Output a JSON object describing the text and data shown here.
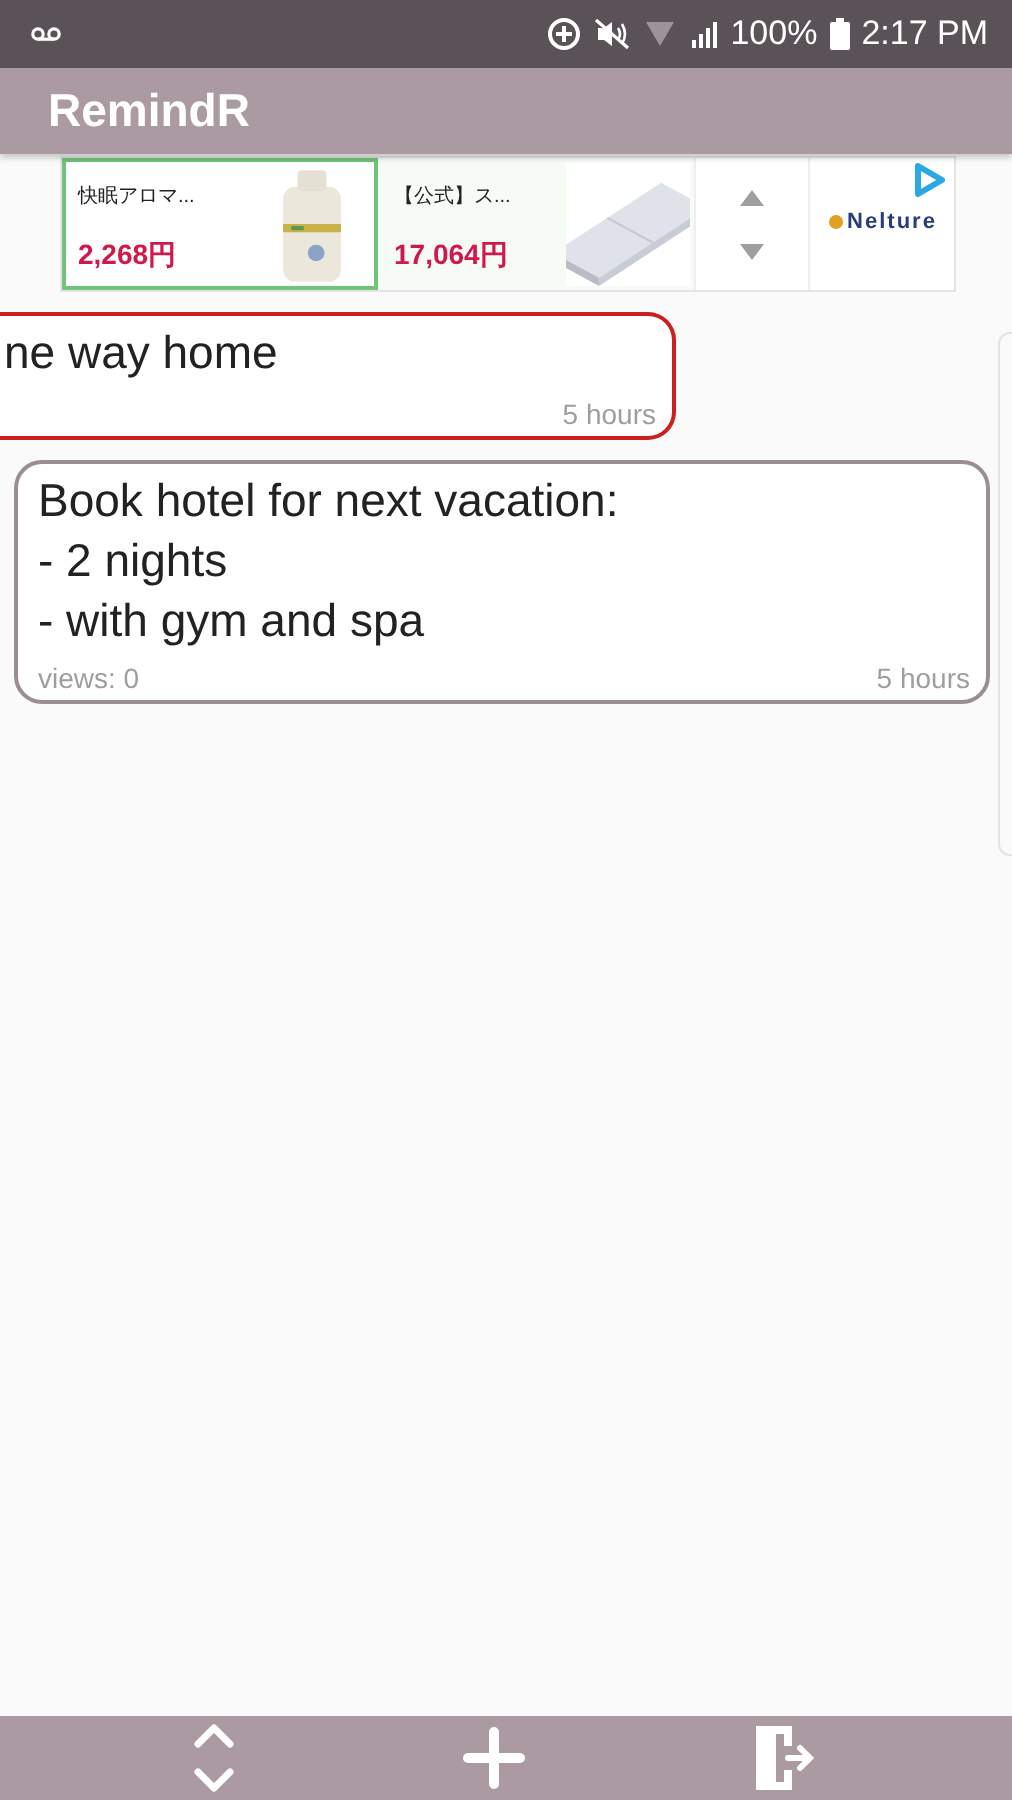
{
  "status_bar": {
    "battery": "100%",
    "time": "2:17 PM"
  },
  "app_bar": {
    "title": "RemindR"
  },
  "ad": {
    "items": [
      {
        "name": "快眠アロマ...",
        "price": "2,268円",
        "selected": true
      },
      {
        "name": "【公式】ス...",
        "price": "17,064円",
        "selected": false
      }
    ],
    "brand": "Nelture"
  },
  "notes": [
    {
      "kind": "swiped",
      "text": "ne way home",
      "time": "5 hours",
      "color": "#cc1f1f"
    },
    {
      "kind": "normal",
      "text": "Book hotel for next vacation:\n- 2 nights\n- with gym and spa",
      "views": "views: 0",
      "time": "5 hours",
      "color": "#9a8e94"
    }
  ]
}
